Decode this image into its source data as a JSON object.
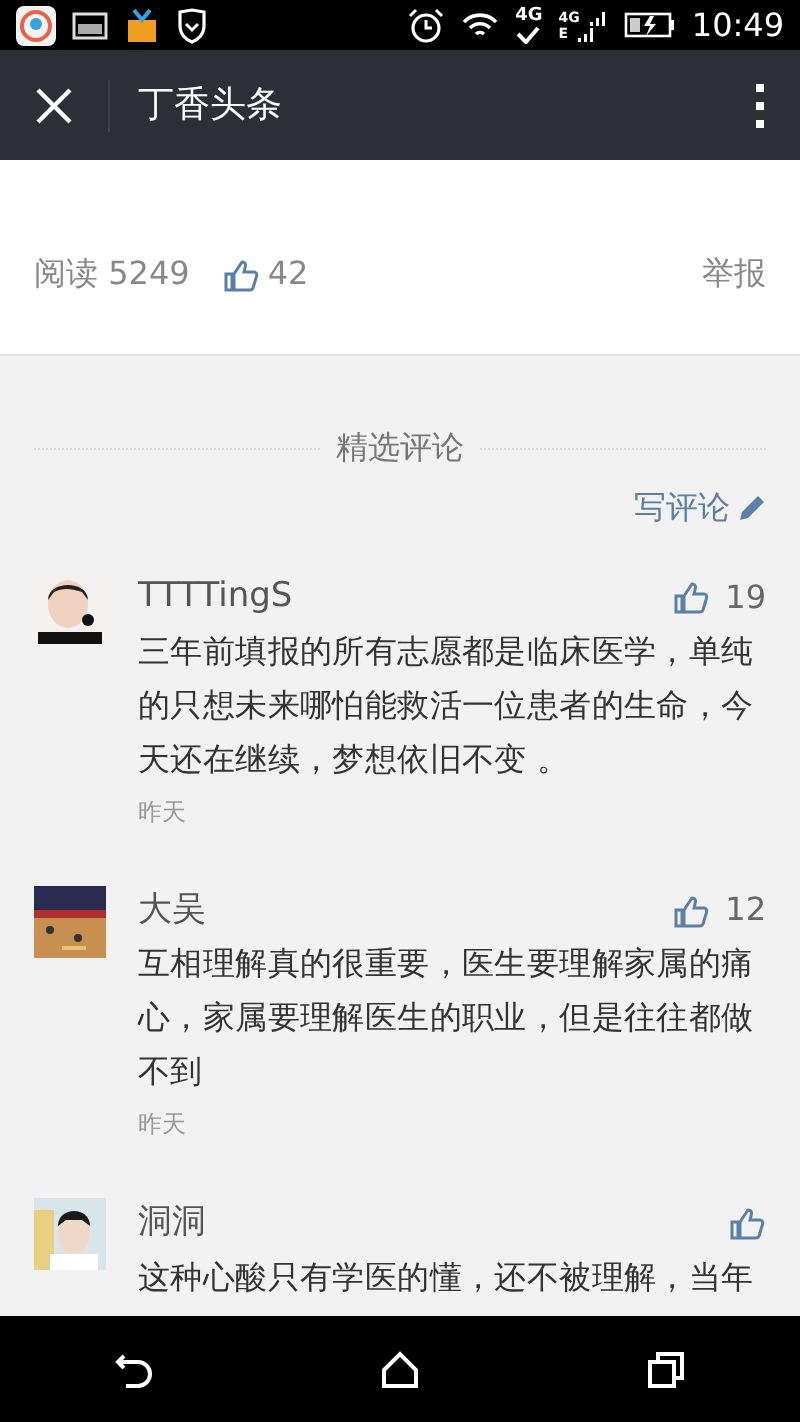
{
  "status_bar": {
    "time": "10:49",
    "network_labels": [
      "4G",
      "4G",
      "E"
    ]
  },
  "toolbar": {
    "title": "丁香头条"
  },
  "article_stats": {
    "reads_label": "阅读",
    "reads": "5249",
    "likes": "42",
    "report": "举报"
  },
  "comments_section": {
    "title": "精选评论",
    "write_comment": "写评论"
  },
  "comments": [
    {
      "user": "TTTTingS",
      "likes": "19",
      "text": "三年前填报的所有志愿都是临床医学，单纯的只想未来哪怕能救活一位患者的生命，今天还在继续，梦想依旧不变 。",
      "time": "昨天"
    },
    {
      "user": "大吴",
      "likes": "12",
      "text": "互相理解真的很重要，医生要理解家属的痛心，家属要理解医生的职业，但是往往都做不到",
      "time": "昨天"
    },
    {
      "user": "洞洞",
      "text": "这种心酸只有学医的懂，还不被理解，当年"
    }
  ]
}
